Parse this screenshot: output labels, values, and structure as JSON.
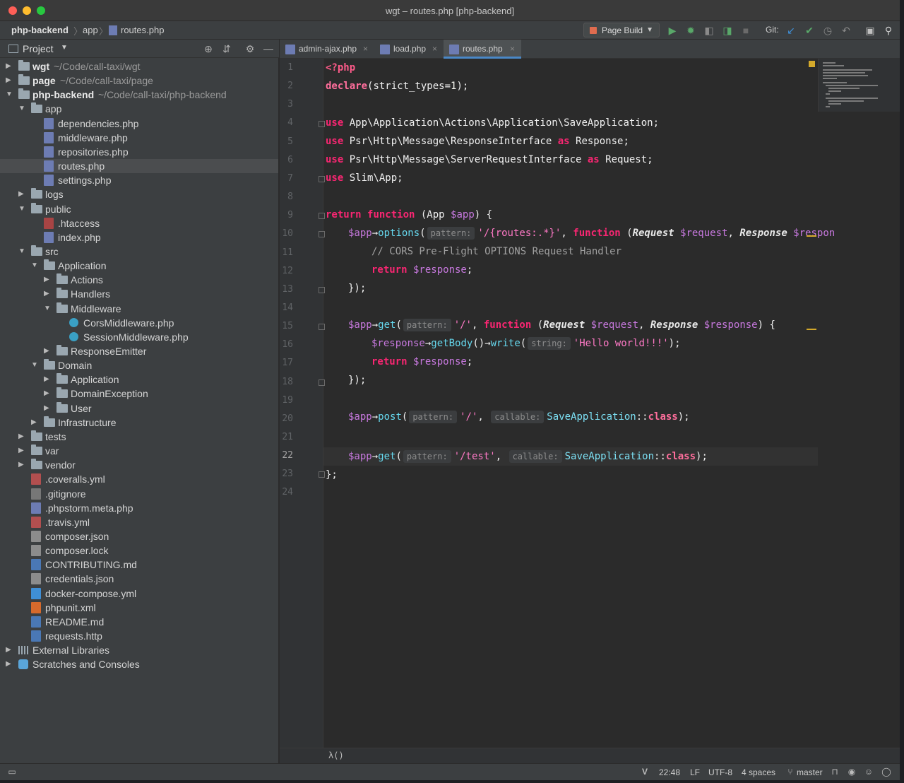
{
  "window": {
    "title": "wgt – routes.php [php-backend]"
  },
  "breadcrumbs": [
    {
      "label": "php-backend"
    },
    {
      "label": "app"
    },
    {
      "label": "routes.php"
    }
  ],
  "toolbar": {
    "run_config": "Page Build",
    "git_label": "Git:"
  },
  "project_panel": {
    "title": "Project",
    "tree": [
      {
        "label": "wgt",
        "path": "~/Code/call-taxi/wgt",
        "type": "folder",
        "depth": 0,
        "expanded": false,
        "bold": true
      },
      {
        "label": "page",
        "path": "~/Code/call-taxi/page",
        "type": "folder",
        "depth": 0,
        "expanded": false,
        "bold": true
      },
      {
        "label": "php-backend",
        "path": "~/Code/call-taxi/php-backend",
        "type": "folder",
        "depth": 0,
        "expanded": true,
        "bold": true
      },
      {
        "label": "app",
        "type": "folder",
        "depth": 1,
        "expanded": true
      },
      {
        "label": "dependencies.php",
        "type": "php",
        "depth": 2
      },
      {
        "label": "middleware.php",
        "type": "php",
        "depth": 2
      },
      {
        "label": "repositories.php",
        "type": "php",
        "depth": 2
      },
      {
        "label": "routes.php",
        "type": "php",
        "depth": 2,
        "selected": true
      },
      {
        "label": "settings.php",
        "type": "php",
        "depth": 2
      },
      {
        "label": "logs",
        "type": "folder",
        "depth": 1,
        "expanded": false
      },
      {
        "label": "public",
        "type": "folder",
        "depth": 1,
        "expanded": true
      },
      {
        "label": ".htaccess",
        "type": "ht",
        "depth": 2
      },
      {
        "label": "index.php",
        "type": "php",
        "depth": 2
      },
      {
        "label": "src",
        "type": "folder",
        "depth": 1,
        "expanded": true
      },
      {
        "label": "Application",
        "type": "folder",
        "depth": 2,
        "expanded": true
      },
      {
        "label": "Actions",
        "type": "folder",
        "depth": 3,
        "expanded": false
      },
      {
        "label": "Handlers",
        "type": "folder",
        "depth": 3,
        "expanded": false
      },
      {
        "label": "Middleware",
        "type": "folder",
        "depth": 3,
        "expanded": true
      },
      {
        "label": "CorsMiddleware.php",
        "type": "class",
        "depth": 4
      },
      {
        "label": "SessionMiddleware.php",
        "type": "class",
        "depth": 4
      },
      {
        "label": "ResponseEmitter",
        "type": "folder",
        "depth": 3,
        "expanded": false
      },
      {
        "label": "Domain",
        "type": "folder",
        "depth": 2,
        "expanded": true
      },
      {
        "label": "Application",
        "type": "folder",
        "depth": 3,
        "expanded": false
      },
      {
        "label": "DomainException",
        "type": "folder",
        "depth": 3,
        "expanded": false
      },
      {
        "label": "User",
        "type": "folder",
        "depth": 3,
        "expanded": false
      },
      {
        "label": "Infrastructure",
        "type": "folder",
        "depth": 2,
        "expanded": false
      },
      {
        "label": "tests",
        "type": "folder",
        "depth": 1,
        "expanded": false
      },
      {
        "label": "var",
        "type": "folder",
        "depth": 1,
        "expanded": false
      },
      {
        "label": "vendor",
        "type": "folder",
        "depth": 1,
        "expanded": false
      },
      {
        "label": ".coveralls.yml",
        "type": "yml",
        "depth": 1
      },
      {
        "label": ".gitignore",
        "type": "git",
        "depth": 1
      },
      {
        "label": ".phpstorm.meta.php",
        "type": "php",
        "depth": 1
      },
      {
        "label": ".travis.yml",
        "type": "yml",
        "depth": 1
      },
      {
        "label": "composer.json",
        "type": "json",
        "depth": 1
      },
      {
        "label": "composer.lock",
        "type": "json",
        "depth": 1
      },
      {
        "label": "CONTRIBUTING.md",
        "type": "md",
        "depth": 1
      },
      {
        "label": "credentials.json",
        "type": "json",
        "depth": 1
      },
      {
        "label": "docker-compose.yml",
        "type": "dc",
        "depth": 1
      },
      {
        "label": "phpunit.xml",
        "type": "xml",
        "depth": 1
      },
      {
        "label": "README.md",
        "type": "md",
        "depth": 1
      },
      {
        "label": "requests.http",
        "type": "http",
        "depth": 1
      },
      {
        "label": "External Libraries",
        "type": "lib",
        "depth": 0,
        "expanded": false
      },
      {
        "label": "Scratches and Consoles",
        "type": "scratch",
        "depth": 0,
        "expanded": false
      }
    ]
  },
  "tabs": [
    {
      "label": "admin-ajax.php",
      "active": false
    },
    {
      "label": "load.php",
      "active": false
    },
    {
      "label": "routes.php",
      "active": true
    }
  ],
  "editor": {
    "current_line": 22,
    "line_numbers": [
      "1",
      "2",
      "3",
      "4",
      "5",
      "6",
      "7",
      "8",
      "9",
      "10",
      "11",
      "12",
      "13",
      "14",
      "15",
      "16",
      "17",
      "18",
      "19",
      "20",
      "21",
      "22",
      "23",
      "24"
    ],
    "code": {
      "l1": "<?php",
      "l2_kw": "declare",
      "l2_rest": "(strict_types=",
      "l2_num": "1",
      "l2_end": ");",
      "use": "use",
      "as": "as",
      "l4_ns": " App\\Application\\Actions\\Application\\SaveApplication;",
      "l5_ns": " Psr\\Http\\Message\\ResponseInterface ",
      "l5_alias": " Response;",
      "l6_ns": " Psr\\Http\\Message\\ServerRequestInterface ",
      "l6_alias": " Request;",
      "l7_ns": " Slim\\App;",
      "return": "return",
      "function": "function",
      "l9_rest": " (App ",
      "app_var": "$app",
      "l9_end": ") {",
      "arrow": "→",
      "options": "options",
      "hint_pattern": "pattern:",
      "hint_string": "string:",
      "hint_callable": "callable:",
      "l10_str": "'/{routes:.*}'",
      "l10_paren": " (",
      "request_type": "Request",
      "request_var": " $request",
      "comma": ", ",
      "response_type": "Response",
      "l10_tail_var": " $respon",
      "l11_cmt": "// CORS Pre-Flight OPTIONS Request Handler",
      "response_var": " $response",
      "semi": ";",
      "close_fn": "});",
      "get": "get",
      "post": "post",
      "str_root": "'/'",
      "l15_end": ") {",
      "response_var_plain": "$response",
      "getBody": "getBody",
      "write": "write",
      "hello": "'Hello world!!!'",
      "str_test": "'/test'",
      "save_app": "SaveApplication",
      "dcolon": "::",
      "class_kw": "class",
      "end_call": ");",
      "l23": "};",
      "paren_open": "(",
      "paren_close": ")"
    }
  },
  "editor_footer": {
    "breadcrumb": "λ()"
  },
  "status_bar": {
    "position": "22:48",
    "line_sep": "LF",
    "encoding": "UTF-8",
    "indent": "4 spaces",
    "branch": "master"
  }
}
